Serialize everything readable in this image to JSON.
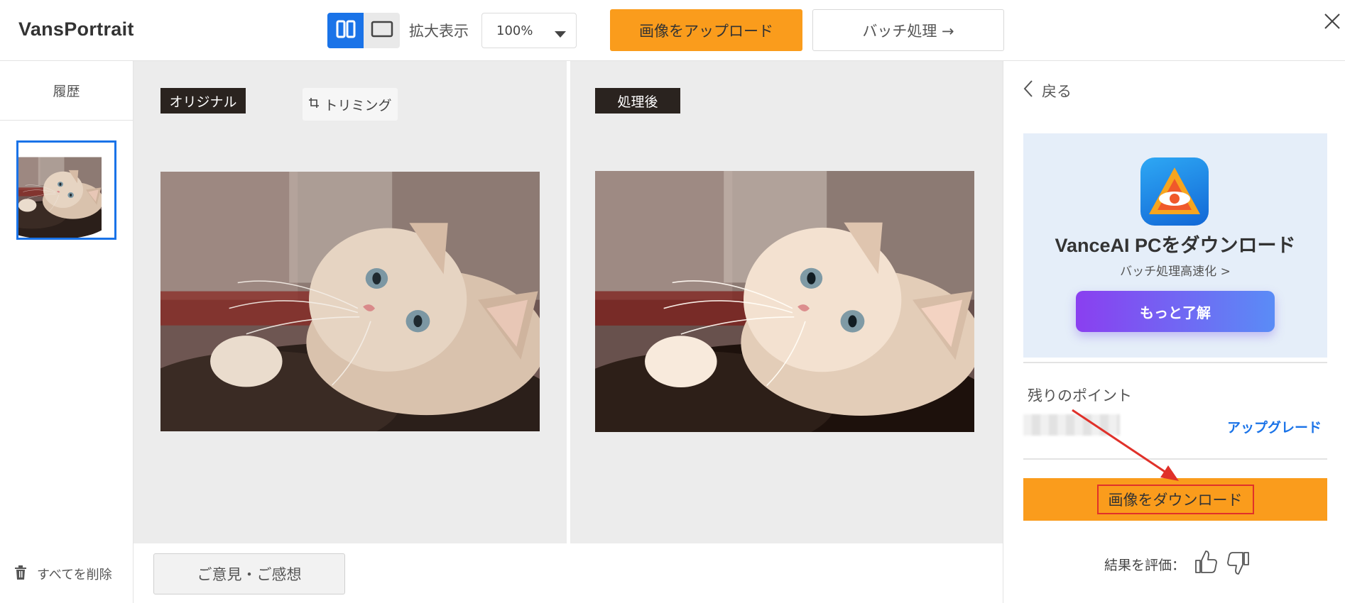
{
  "app": {
    "title": "VansPortrait"
  },
  "toolbar": {
    "zoom_label": "拡大表示",
    "zoom_value": "100%",
    "upload_label": "画像をアップロード",
    "batch_label": "バッチ処理 →"
  },
  "sidebar": {
    "history_label": "履歴",
    "delete_all_label": "すべてを削除"
  },
  "compare": {
    "original_tag": "オリジナル",
    "crop_label": "トリミング",
    "processed_tag": "処理後"
  },
  "feedback": {
    "button_label": "ご意見・ご感想"
  },
  "panel": {
    "back_label": "戻る",
    "promo_title": "VanceAI PCをダウンロード",
    "promo_subtitle": "バッチ処理高速化 >",
    "promo_button": "もっと了解",
    "points_label": "残りのポイント",
    "upgrade_label": "アップグレード",
    "download_label": "画像をダウンロード",
    "rate_label": "結果を評価："
  },
  "colors": {
    "accent_orange": "#fa9c1c",
    "accent_blue": "#1a73e8",
    "tag_dark": "#2a231f",
    "annotation_red": "#e0312a"
  },
  "icons": [
    "split-view-icon",
    "single-view-icon",
    "chevron-down-icon",
    "close-icon",
    "crop-icon",
    "trash-icon",
    "chevron-left-icon",
    "app-logo-icon",
    "thumbs-up-icon",
    "thumbs-down-icon"
  ]
}
